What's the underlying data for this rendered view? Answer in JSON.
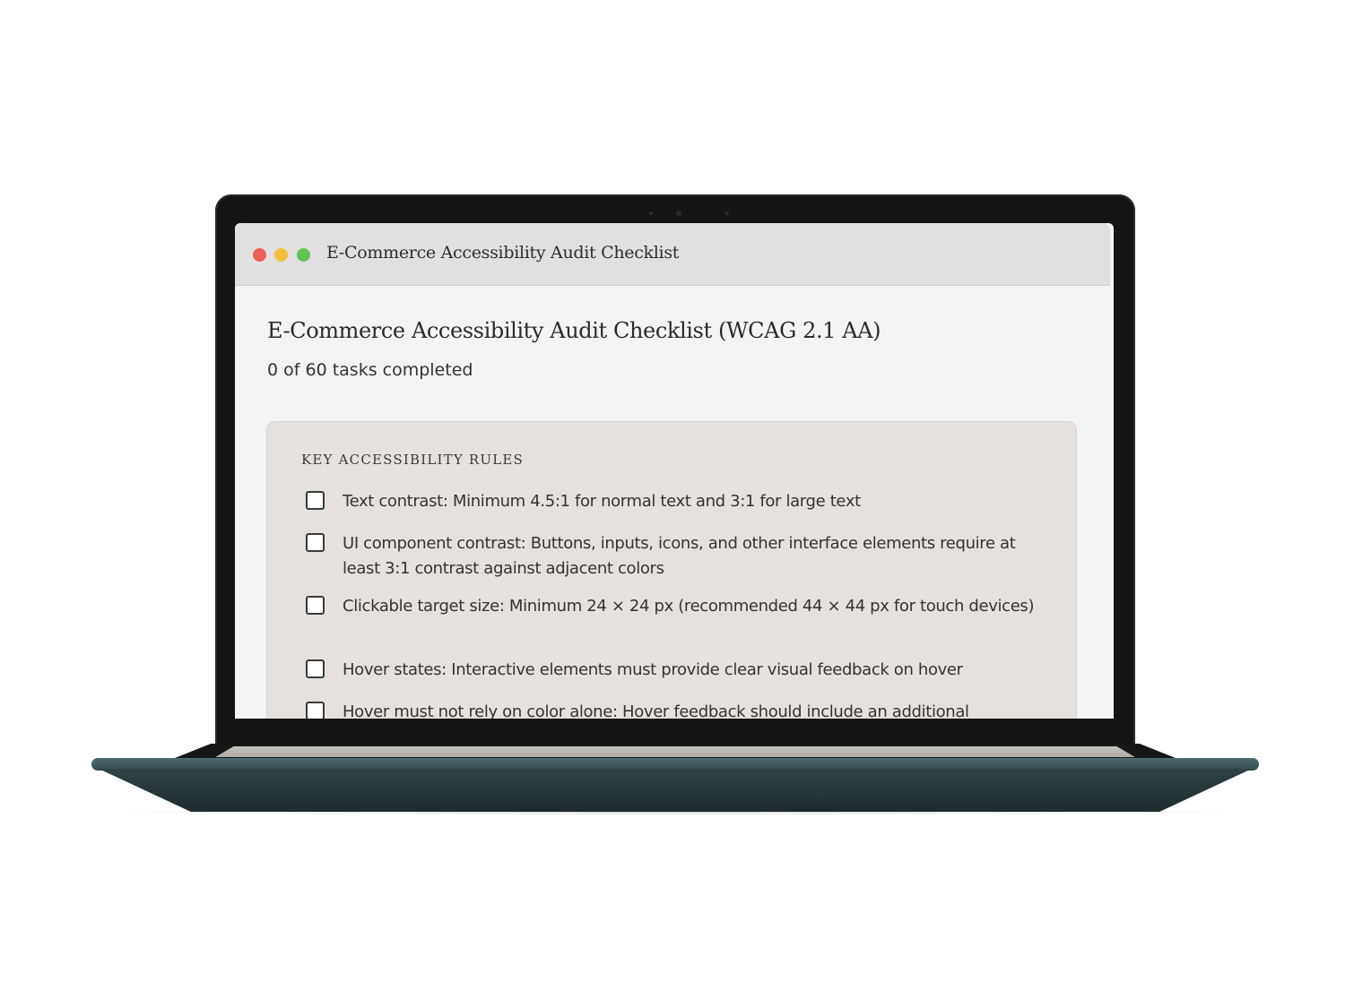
{
  "window": {
    "title": "E-Commerce Accessibility Audit Checklist",
    "traffic_lights": [
      "#ee5f57",
      "#f5bd3c",
      "#5fc452"
    ]
  },
  "page": {
    "title": "E-Commerce Accessibility Audit Checklist (WCAG 2.1 AA)",
    "progress": "0 of 60 tasks completed"
  },
  "rules": {
    "heading": "KEY ACCESSIBILITY RULES",
    "items": [
      {
        "label": "Text contrast: Minimum 4.5:1 for normal text and 3:1 for large text",
        "checked": false
      },
      {
        "label": "UI component contrast: Buttons, inputs, icons, and other interface elements require at least 3:1 contrast against adjacent colors",
        "checked": false
      },
      {
        "label": "Clickable target size: Minimum 24 × 24 px (recommended 44 × 44 px for touch devices)",
        "checked": false
      },
      {
        "label": "Hover states: Interactive elements must provide clear visual feedback on hover",
        "checked": false
      },
      {
        "label": "Hover must not rely on color alone: Hover feedback should include an additional",
        "checked": false
      }
    ]
  },
  "colors": {
    "screen_bg": "#f4f4f4",
    "titlebar_bg": "#e0e0e0",
    "panel_bg": "#e6e1dd",
    "laptop_base": "#2f4246"
  }
}
